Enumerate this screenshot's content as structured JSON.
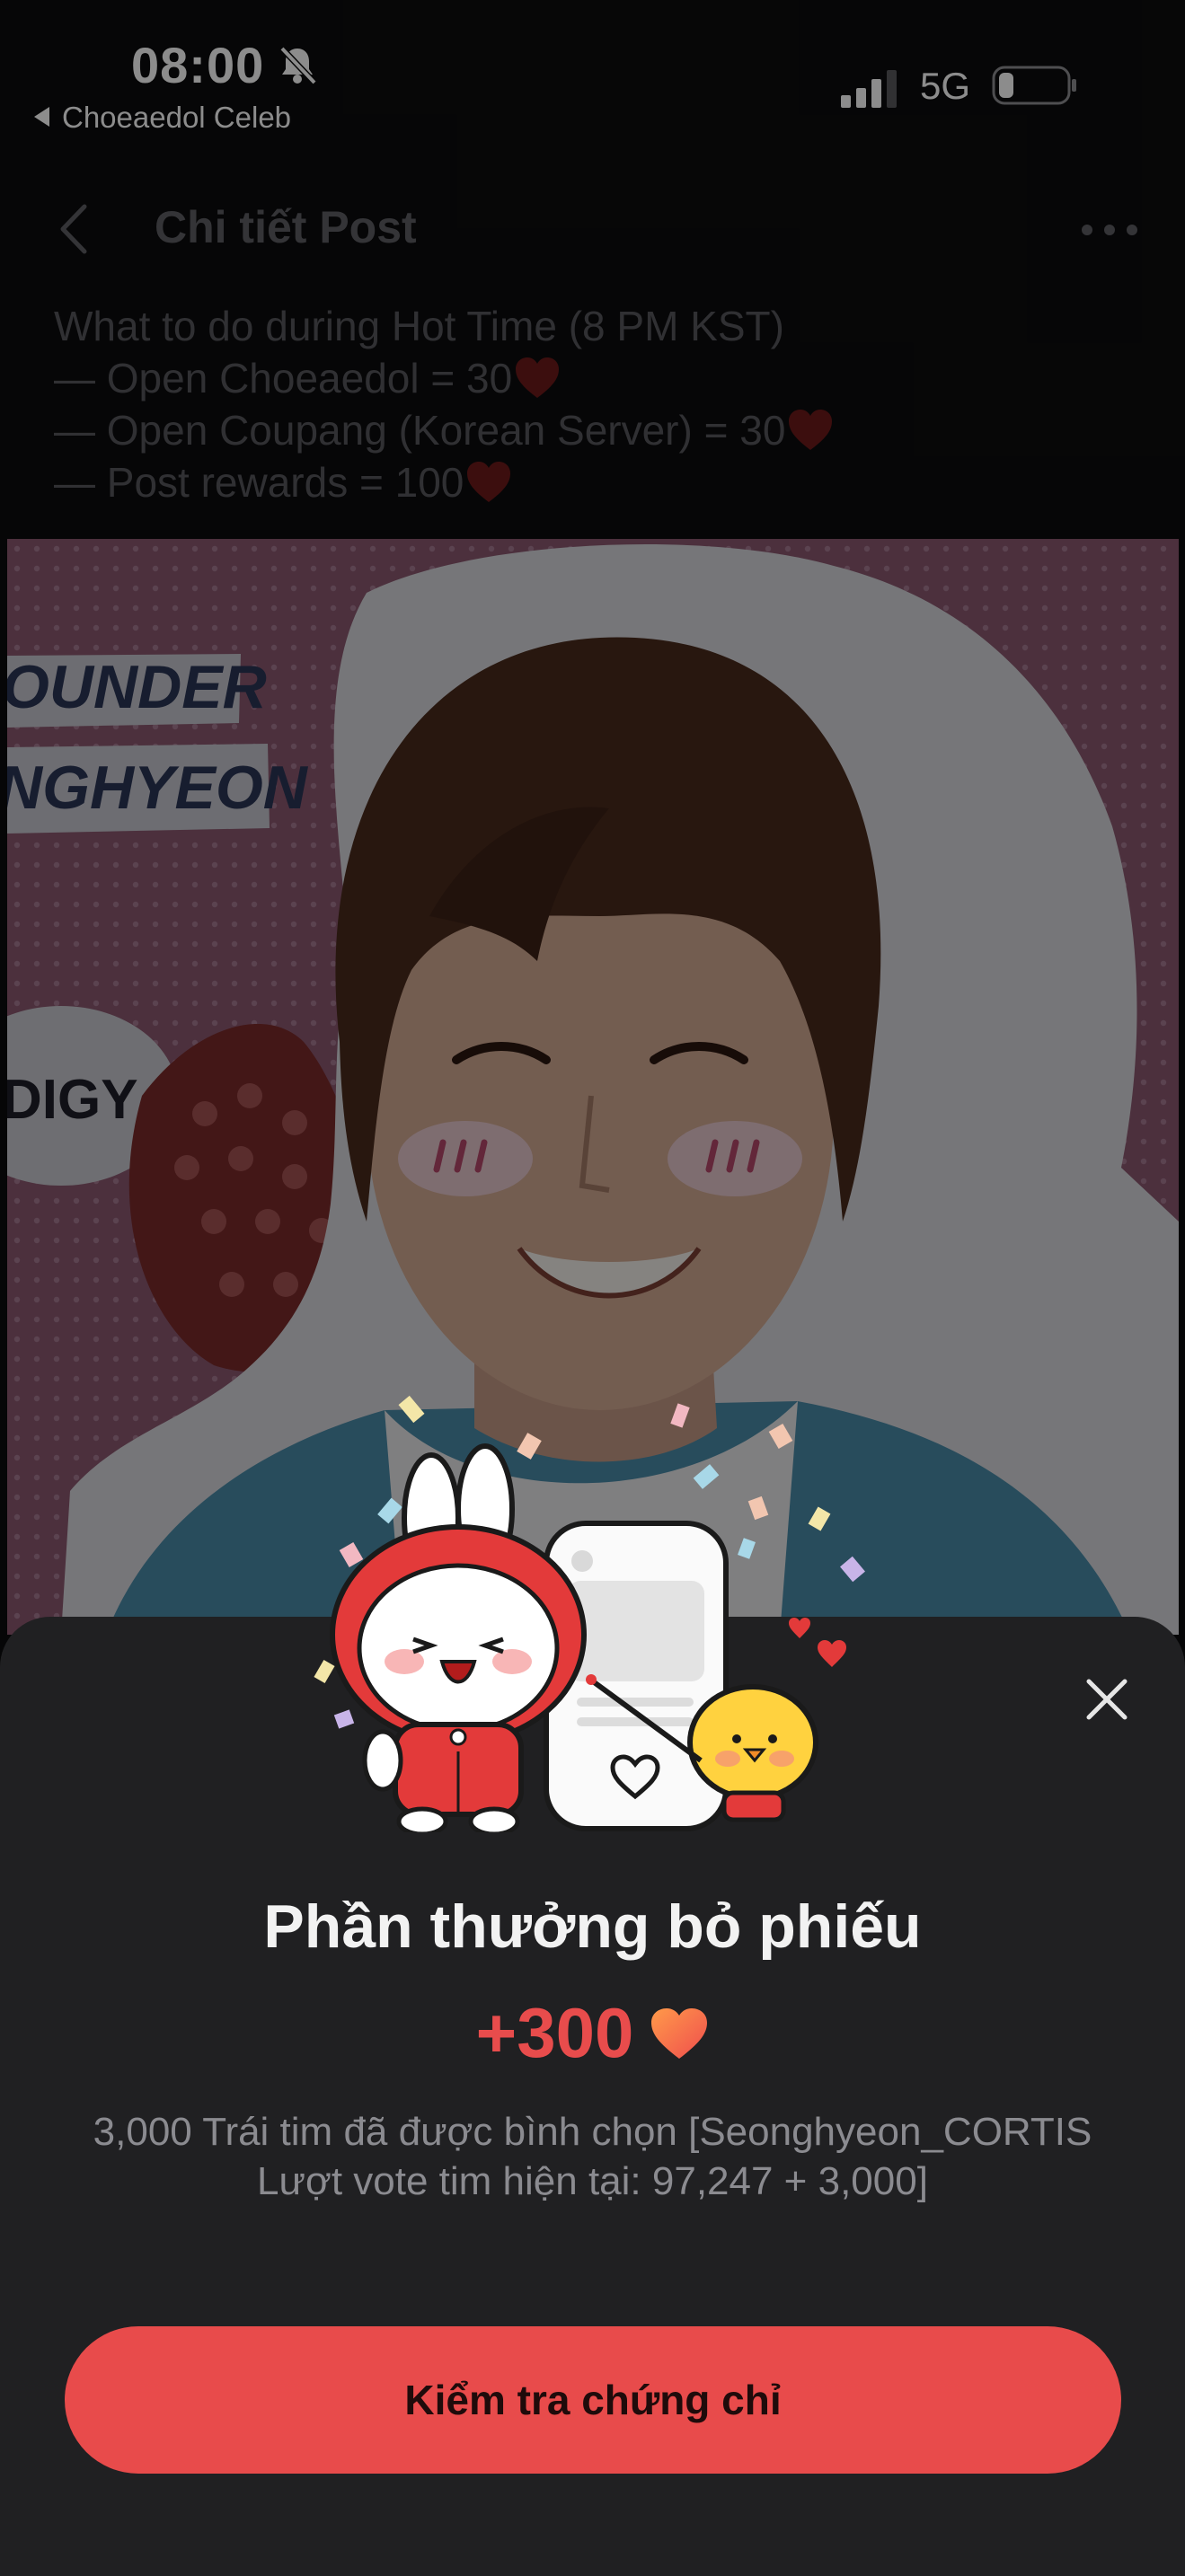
{
  "status_bar": {
    "time": "08:00",
    "back_app": "Choeaedol Celeb",
    "network": "5G",
    "icons": [
      "bell-slash-icon",
      "signal-icon",
      "battery-icon"
    ]
  },
  "header": {
    "title": "Chi tiết Post",
    "back_icon": "chevron-left-icon",
    "more_icon": "more-horizontal-icon"
  },
  "post": {
    "lines": [
      "What to do during Hot Time (8 PM KST)",
      "— Open Choeaedol = 30",
      "— Open Coupang (Korean Server) = 30",
      "— Post rewards = 100"
    ],
    "image_texts": [
      "OUNDER",
      "NGHYEON",
      "DIGY"
    ]
  },
  "reward_sheet": {
    "title": "Phần thưởng bỏ phiếu",
    "amount": "+300",
    "description": "3,000 Trái tim đã được bình chọn [Seonghyeon_CORTIS Lượt vote tim hiện tại: 97,247 + 3,000]",
    "button_label": "Kiểm tra chứng chỉ",
    "close_icon": "close-icon"
  },
  "colors": {
    "accent": "#e84b4b",
    "sheet_background": "#202022",
    "page_background": "#0c0c0d"
  }
}
